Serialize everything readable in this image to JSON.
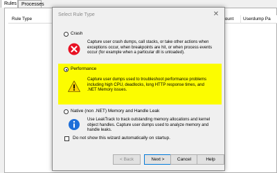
{
  "background": {
    "tabs": [
      {
        "label": "Rules",
        "active": true
      },
      {
        "label": "Processes",
        "active": false
      }
    ],
    "columns": {
      "rule_type": "Rule Type",
      "count": "Count",
      "userdump": "Userdump Pa"
    }
  },
  "dialog": {
    "title": "Select Rule Type",
    "close": "✕",
    "options": [
      {
        "label": "Crash",
        "selected": false,
        "icon": "error-icon",
        "description": "Capture user crash dumps, call stacks, or take other actions when exceptions occur, when breakpoints are hit, or when process events occur (for example when a particular dll is unloaded)."
      },
      {
        "label": "Performance",
        "selected": true,
        "icon": "warning-icon",
        "description": "Capture user dumps used to troubleshoot performance problems including high CPU, deadlocks, long HTTP response times, and .NET Memory issues."
      },
      {
        "label": "Native (non .NET) Memory and Handle Leak",
        "selected": false,
        "icon": "info-icon",
        "description": "Use LeakTrack to track outstanding memory allocations and kernel object handles. Capture user dumps used to analyze memory and handle leaks."
      }
    ],
    "checkbox_label": "Do not show this wizard automatically on startup.",
    "checkbox_checked": false,
    "buttons": {
      "back": "< Back",
      "next": "Next >",
      "cancel": "Cancel",
      "help": "Help"
    },
    "colors": {
      "highlight": "#fcfc00",
      "error": "#e81123",
      "warning": "#ffd400"
    }
  }
}
